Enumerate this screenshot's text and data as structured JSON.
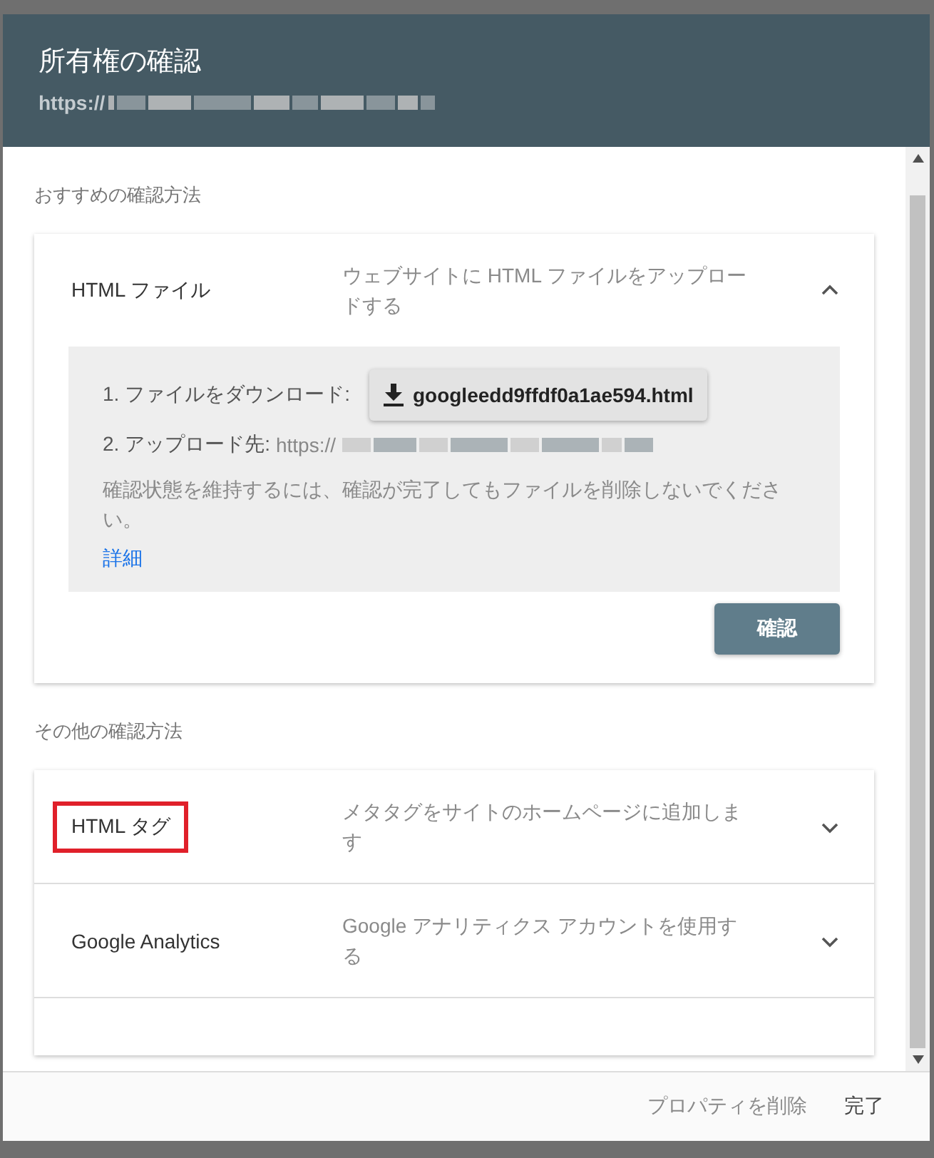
{
  "dialog": {
    "title": "所有権の確認",
    "url": "https://"
  },
  "recommended": {
    "heading": "おすすめの確認方法",
    "method": {
      "name": "HTML ファイル",
      "description": "ウェブサイトに HTML ファイルをアップロードする",
      "expanded": true,
      "step_1": "1. ファイルをダウンロード:",
      "download_button": "googleedd9ffdf0a1ae594.html",
      "step_2": "2. アップロード先:",
      "upload_url": "https://",
      "note": "確認状態を維持するには、確認が完了してもファイルを削除しないでください。",
      "link": "詳細"
    },
    "verify_button": "確認"
  },
  "other": {
    "heading": "その他の確認方法",
    "methods": [
      {
        "name": "HTML タグ",
        "description": "メタタグをサイトのホームページに追加します",
        "expanded": false,
        "highlighted": true
      },
      {
        "name": "Google Analytics",
        "description": "Google アナリティクス アカウントを使用する",
        "expanded": false,
        "highlighted": false
      }
    ]
  },
  "footer": {
    "buttons": [
      {
        "label": "プロパティを削除",
        "kind": "secondary"
      },
      {
        "label": "完了",
        "kind": "primary"
      }
    ]
  }
}
